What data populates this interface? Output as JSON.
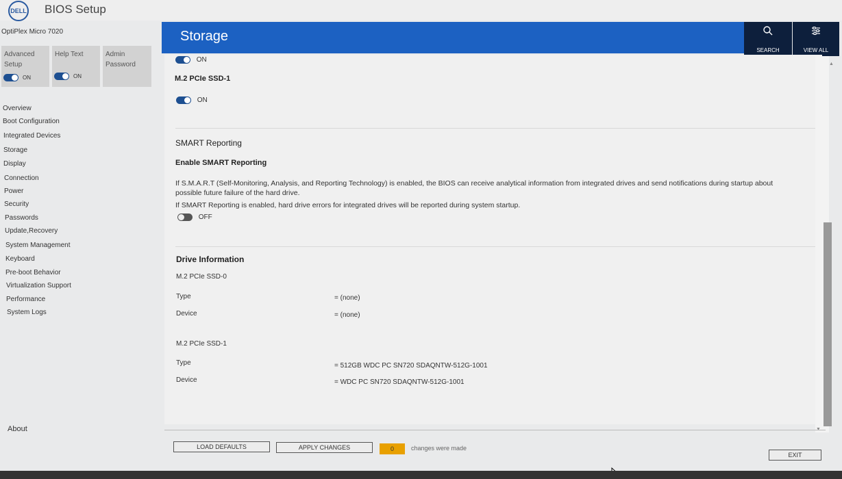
{
  "app": {
    "logo": "DELL",
    "title": "BIOS Setup",
    "model": "OptiPlex Micro 7020"
  },
  "tiles": [
    {
      "label_line1": "Advanced",
      "label_line2": "Setup",
      "toggle": "ON"
    },
    {
      "label_line1": "Help Text",
      "label_line2": "",
      "toggle": "ON"
    },
    {
      "label_line1": "Admin",
      "label_line2": "Password",
      "toggle": ""
    }
  ],
  "nav": [
    "Overview",
    "Boot Configuration",
    "Integrated Devices",
    "Storage",
    "Display",
    "Connection",
    "Power",
    "Security",
    "Passwords",
    "Update,Recovery",
    "System Management",
    "Keyboard",
    "Pre-boot Behavior",
    "Virtualization Support",
    "Performance",
    "System Logs"
  ],
  "about": "About",
  "header": {
    "title": "Storage",
    "search_label": "SEARCH",
    "view_all_label": "VIEW ALL"
  },
  "content": {
    "top_toggle": "ON",
    "ssd1_title": "M.2 PCIe SSD-1",
    "ssd1_toggle": "ON",
    "smart_section": "SMART Reporting",
    "smart_option": "Enable SMART Reporting",
    "smart_desc_line1": "If S.M.A.R.T (Self-Monitoring, Analysis, and Reporting Technology) is enabled, the BIOS can receive analytical information from integrated drives and send notifications during startup about",
    "smart_desc_line2": "possible future failure of the hard drive.",
    "smart_desc_line3": "If SMART Reporting is enabled, hard drive errors for integrated drives will be reported during system startup.",
    "smart_toggle": "OFF",
    "drive_info_title": "Drive Information",
    "drives": [
      {
        "name": "M.2 PCIe SSD-0",
        "type_label": "Type",
        "type_value": "= (none)",
        "device_label": "Device",
        "device_value": "= (none)"
      },
      {
        "name": "M.2 PCIe SSD-1",
        "type_label": "Type",
        "type_value": "= 512GB WDC PC SN720 SDAQNTW-512G-1001",
        "device_label": "Device",
        "device_value": "= WDC PC SN720 SDAQNTW-512G-1001"
      }
    ]
  },
  "footer": {
    "load_defaults": "LOAD DEFAULTS",
    "apply_changes": "APPLY CHANGES",
    "change_count": "0",
    "changes_text": "changes were made",
    "exit": "EXIT"
  },
  "colors": {
    "header_blue": "#1c61c2",
    "header_dark": "#0d1f3c",
    "toggle_on": "#1d4f91",
    "badge_orange": "#e8a000"
  }
}
